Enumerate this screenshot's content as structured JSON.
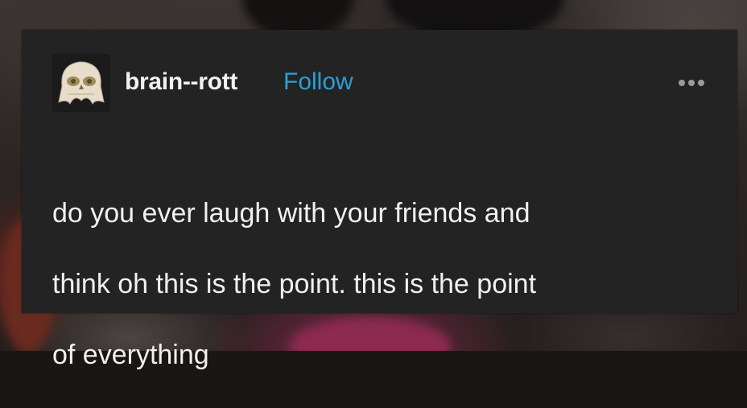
{
  "background": {
    "description_colors": [
      "#3b3634",
      "#241f1e",
      "#8c2a4f",
      "#6a2a20"
    ]
  },
  "post": {
    "card_color": "#232323",
    "avatar_icon": "skull-avatar-icon",
    "username": "brain--rott",
    "follow_label": "Follow",
    "follow_color": "#2a9fd6",
    "more_icon": "more-options-icon",
    "body_lines": [
      "do you ever laugh with your friends and",
      "think oh this is the point. this is the point",
      "of everything"
    ]
  }
}
